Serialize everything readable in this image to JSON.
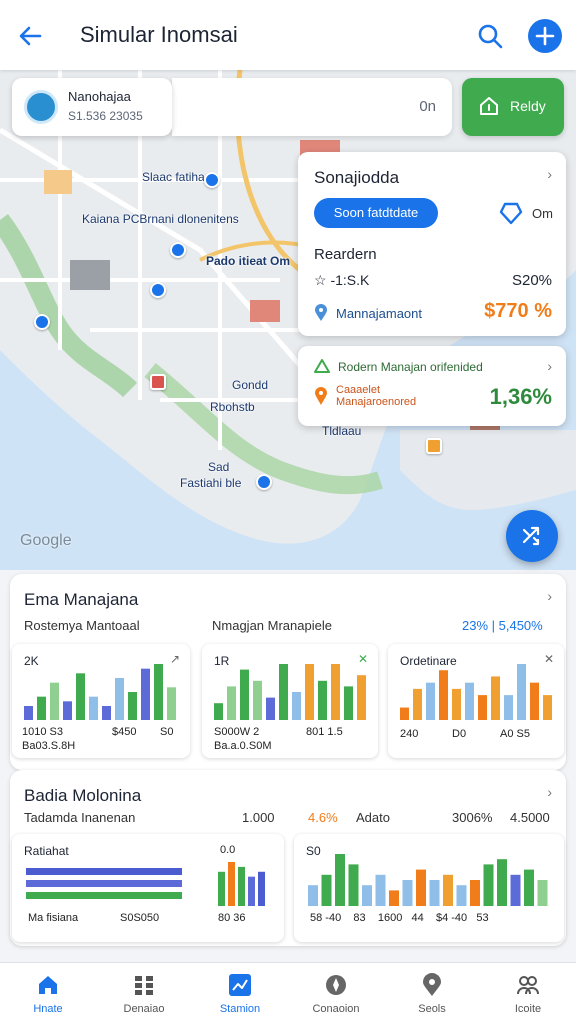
{
  "header": {
    "title": "Simular Inomsai",
    "back_icon": "arrow-left-icon",
    "search_icon": "search-icon",
    "add_icon": "plus-icon"
  },
  "map": {
    "profile": {
      "name": "Nanohajaa",
      "sub": "S1.536 23035"
    },
    "status_text": "0n",
    "ready_label": "Reldy",
    "labels": [
      "Slaac fatiha",
      "Kaiana PCBrnani dlonenitens",
      "Pado itieat Om",
      "Gondd",
      "Rbohstb",
      "Tldlaau",
      "Sad",
      "Fastiahi ble"
    ],
    "google_label": "Google",
    "fab_icon": "shuffle-icon"
  },
  "info_card": {
    "title": "Sonajiodda",
    "button": "Soon fatdtdate",
    "unit": "Om",
    "subtitle": "Reardern",
    "row1_label": "☆ -1:S.K",
    "row1_value": "S20%",
    "row2_label": "Mannajamaont",
    "row2_value": "$770 %"
  },
  "info_card2": {
    "title": "Rodern Manajan orifenided",
    "label": "Caaaelet Manajaroenored",
    "value": "1,36%"
  },
  "panel1": {
    "title": "Ema Manajana",
    "sub1": "Rostemya Mantoaal",
    "sub2": "Nmagjan Mranapiele",
    "stat": "23% | 5,450%",
    "charts": [
      {
        "label": "2K",
        "ax1": "1010    S3",
        "ax2": "$450",
        "ax3": "S0",
        "foot": "Ba03.S.8H",
        "bar_values": [
          3,
          5,
          8,
          4,
          10,
          5,
          3,
          9,
          6,
          11,
          12,
          7
        ],
        "colors": [
          "#5c6bd8",
          "#3faa4e",
          "#8fcf8f",
          "#5c6bd8",
          "#3faa4e",
          "#8fbfe8",
          "#5c6bd8",
          "#8fbfe8",
          "#3faa4e",
          "#5c6bd8",
          "#3faa4e",
          "#8fcf8f"
        ]
      },
      {
        "label": "1R",
        "ax1": "S000W    2",
        "ax2": "801  1.5",
        "ax3": "",
        "foot": "Ba.a.0.S0M",
        "bar_values": [
          3,
          6,
          9,
          7,
          4,
          10,
          5,
          10,
          7,
          10,
          6,
          8
        ],
        "colors": [
          "#3faa4e",
          "#8fcf8f",
          "#3faa4e",
          "#8fcf8f",
          "#5c6bd8",
          "#3faa4e",
          "#8fbfe8",
          "#f0a030",
          "#3faa4e",
          "#f0a030",
          "#3faa4e",
          "#f0a030"
        ]
      },
      {
        "label": "Ordetinare",
        "ax1": "240",
        "ax2": "D0",
        "ax3": "A0    S5",
        "foot": "",
        "bar_values": [
          2,
          5,
          6,
          8,
          5,
          6,
          4,
          7,
          4,
          9,
          6,
          4
        ],
        "colors": [
          "#f07d1a",
          "#f0a030",
          "#8fbfe8",
          "#f07d1a",
          "#f0a030",
          "#8fbfe8",
          "#f07d1a",
          "#f0a030",
          "#8fbfe8",
          "#8fbfe8",
          "#f07d1a",
          "#f0a030"
        ]
      }
    ]
  },
  "panel2": {
    "title": "Badia Molonina",
    "sub1": "Tadamda Inanenan",
    "sub2": "1.000",
    "stat1": "4.6%",
    "stat2": "Adato",
    "stat3": "3006%",
    "stat4": "4.5000",
    "left_chart": {
      "label": "Ratiahat",
      "foot1": "Ma fisiana",
      "foot2": "S0S050",
      "hbar_values": [
        7,
        7,
        7
      ],
      "hbar_colors": [
        "#4a5ccf",
        "#5c6bd8",
        "#3faa4e"
      ],
      "side_label": "0.0",
      "side_values": [
        7,
        9,
        8,
        6,
        7
      ],
      "side_colors": [
        "#3faa4e",
        "#f07d1a",
        "#3faa4e",
        "#5c6bd8",
        "#4a5ccf"
      ],
      "side_foot": "80    36"
    },
    "right_chart": {
      "label": "S0",
      "foot": "58 -40    83    1600   44    $4 -40   53",
      "bar_values": [
        4,
        6,
        10,
        8,
        4,
        6,
        3,
        5,
        7,
        5,
        6,
        4,
        5,
        8,
        9,
        6,
        7,
        5
      ],
      "colors": [
        "#8fbfe8",
        "#3faa4e",
        "#3faa4e",
        "#3faa4e",
        "#8fbfe8",
        "#8fbfe8",
        "#f07d1a",
        "#8fbfe8",
        "#f07d1a",
        "#8fbfe8",
        "#f0a030",
        "#8fbfe8",
        "#f07d1a",
        "#3faa4e",
        "#3faa4e",
        "#5c6bd8",
        "#3faa4e",
        "#8fcf8f"
      ]
    }
  },
  "nav": [
    {
      "label": "Hnate",
      "icon": "home-icon",
      "active": true
    },
    {
      "label": "Denaiao",
      "icon": "grid-icon",
      "active": false
    },
    {
      "label": "Stamion",
      "icon": "chart-icon",
      "active": true
    },
    {
      "label": "Conaoion",
      "icon": "compass-icon",
      "active": false
    },
    {
      "label": "Seols",
      "icon": "pin-icon",
      "active": false
    },
    {
      "label": "Icoite",
      "icon": "people-icon",
      "active": false
    }
  ]
}
